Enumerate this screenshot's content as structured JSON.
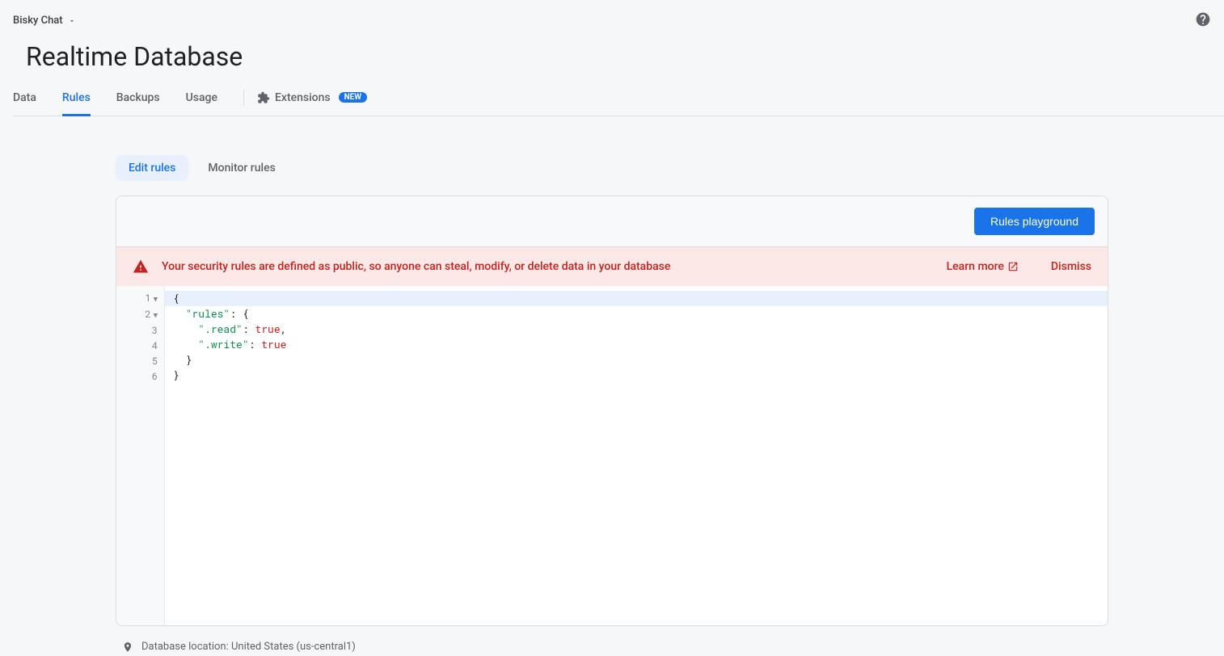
{
  "header": {
    "project_name": "Bisky Chat",
    "page_title": "Realtime Database"
  },
  "tabs": [
    {
      "id": "data",
      "label": "Data"
    },
    {
      "id": "rules",
      "label": "Rules"
    },
    {
      "id": "backups",
      "label": "Backups"
    },
    {
      "id": "usage",
      "label": "Usage"
    },
    {
      "id": "extensions",
      "label": "Extensions"
    }
  ],
  "new_badge": "NEW",
  "subtabs": {
    "edit": "Edit rules",
    "monitor": "Monitor rules"
  },
  "card": {
    "playground_button": "Rules playground"
  },
  "alert": {
    "message": "Your security rules are defined as public, so anyone can steal, modify, or delete data in your database",
    "learn_more": "Learn more",
    "dismiss": "Dismiss"
  },
  "editor": {
    "line_numbers": [
      "1",
      "2",
      "3",
      "4",
      "5",
      "6"
    ],
    "code": {
      "rules_key": "\"rules\"",
      "read_key": "\".read\"",
      "write_key": "\".write\"",
      "true_val": "true"
    }
  },
  "footer": {
    "location": "Database location: United States (us-central1)"
  }
}
